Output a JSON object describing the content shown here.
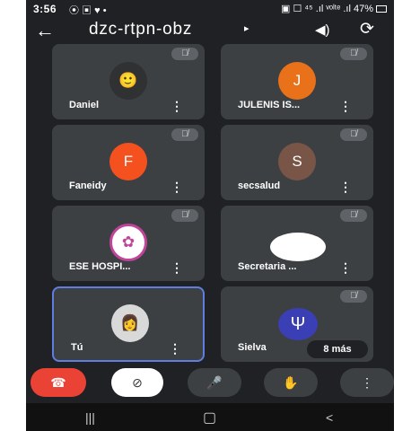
{
  "status": {
    "time": "3:56",
    "notification_icons": "⦿ ▣ ♥ •",
    "right_icons": "▣ ☐ ⁴⁵ .ıl ᵛᵒˡᵗᵉ .ıl",
    "battery": "47%"
  },
  "header": {
    "meeting_code": "dzc-rtpn-obz",
    "caret": "▸",
    "back_icon": "←",
    "speaker_icon": "◀)",
    "flip_icon": "⟳"
  },
  "participants": [
    {
      "name": "Daniel",
      "avatar_type": "emoji",
      "avatar_text": "🙂",
      "avatar_color": "#2f3133"
    },
    {
      "name": "JULENIS IS...",
      "avatar_type": "letter",
      "avatar_text": "J",
      "avatar_color": "#e8711a"
    },
    {
      "name": "Faneidy",
      "avatar_type": "letter",
      "avatar_text": "F",
      "avatar_color": "#f4511e"
    },
    {
      "name": "secsalud",
      "avatar_type": "letter",
      "avatar_text": "S",
      "avatar_color": "#795548"
    },
    {
      "name": "ESE HOSPI...",
      "avatar_type": "logo",
      "avatar_text": "✿",
      "avatar_color": "#ffffff"
    },
    {
      "name": "Secretaria ...",
      "avatar_type": "oval",
      "avatar_text": "",
      "avatar_color": "#ffffff"
    },
    {
      "name": "Tú",
      "avatar_type": "photo",
      "avatar_text": "👩",
      "avatar_color": "#d9d9d9"
    },
    {
      "name": "Sielva",
      "avatar_type": "psi",
      "avatar_text": "Ψ",
      "avatar_color": "#3b3fb5"
    }
  ],
  "more_participants": "8 más",
  "controls": {
    "end_icon": "☎",
    "camera_icon": "⊘",
    "mic_icon": "🎤",
    "hand_icon": "✋",
    "more_icon": "⋮"
  },
  "nav": {
    "recents": "|||",
    "home": "▢",
    "back": "<"
  },
  "colors": {
    "background": "#202124",
    "tile": "#3c4043",
    "end_call": "#ea4335",
    "self_border": "#5f7ee0"
  }
}
